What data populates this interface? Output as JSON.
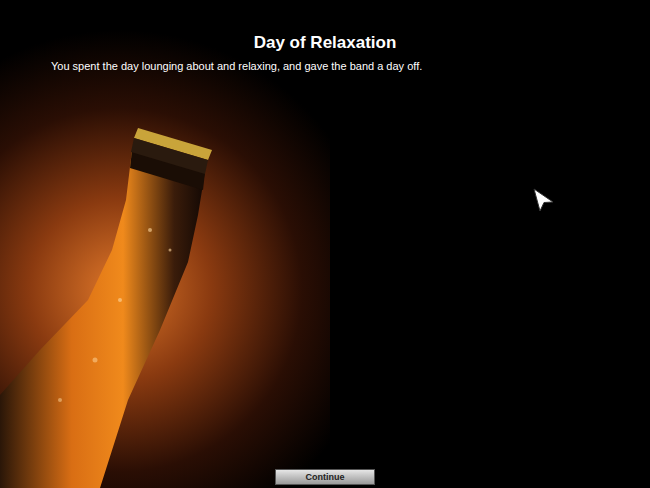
{
  "screen": {
    "title": "Day of Relaxation",
    "message": "You spent the day lounging about and relaxing, and gave the band a day off."
  },
  "buttons": [
    "Continue"
  ]
}
